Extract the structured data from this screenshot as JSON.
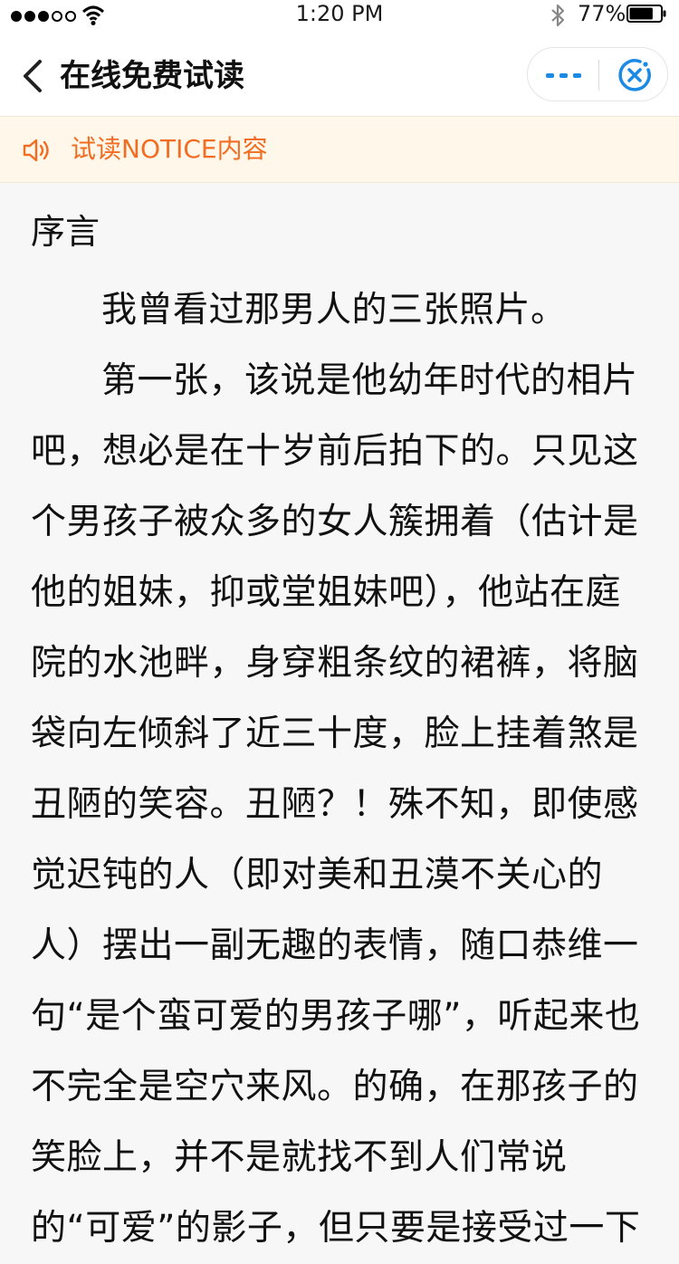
{
  "status_bar": {
    "time": "1:20 PM",
    "battery_percent": "77%",
    "battery_level": 0.77,
    "signal_bars_filled": 3,
    "signal_bars_total": 5
  },
  "nav": {
    "title": "在线免费试读",
    "back_icon": "chevron-left-icon",
    "more_icon": "more-dots-icon",
    "close_icon": "close-circle-icon",
    "accent_color": "#1a8ae5"
  },
  "notice": {
    "text": "试读NOTICE内容",
    "icon": "speaker-icon",
    "color": "#f26c21",
    "background": "#fff7e9"
  },
  "article": {
    "chapter_title": "序言",
    "paragraphs": [
      "我曾看过那男人的三张照片。",
      "第一张，该说是他幼年时代的相片吧，想必是在十岁前后拍下的。只见这个男孩子被众多的女人簇拥着（估计是他的姐妹，抑或堂姐妹吧），他站在庭院的水池畔，身穿粗条纹的裙裤，将脑袋向左倾斜了近三十度，脸上挂着煞是丑陋的笑容。丑陋？！殊不知，即使感觉迟钝的人（即对美和丑漠不关心的人）摆出一副无趣的表情，随口恭维一句“是个蛮可爱的男孩子哪”，听起来也不完全是空穴来风。的确，在那孩子的笑脸上，并不是就找不到人们常说的“可爱”的影子，但只要是接受过一下"
    ]
  }
}
